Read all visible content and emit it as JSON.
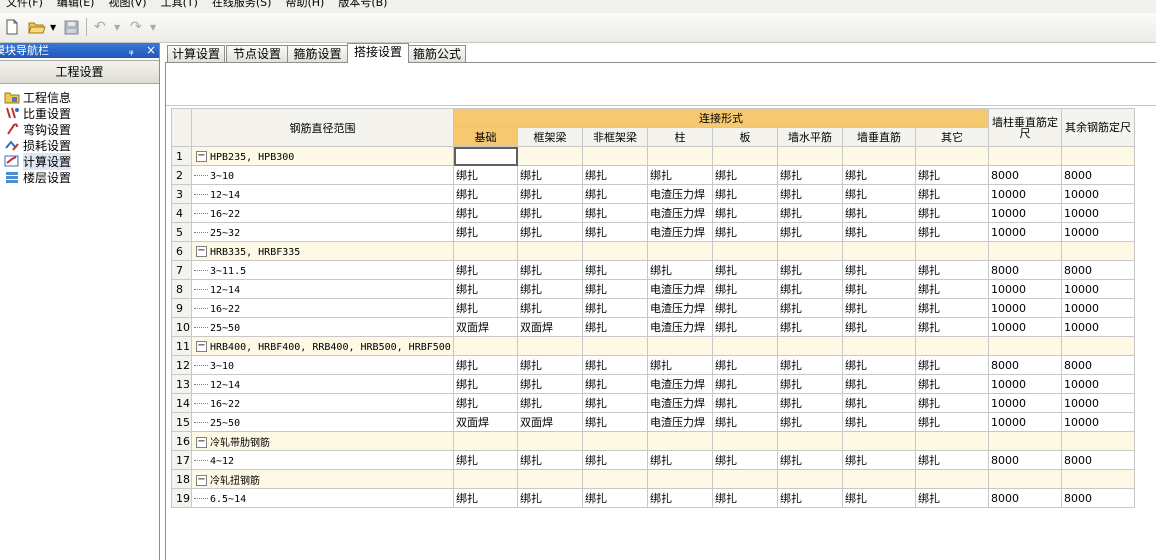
{
  "menu": [
    "文件(F)",
    "编辑(E)",
    "视图(V)",
    "工具(T)",
    "在线服务(S)",
    "帮助(H)",
    "版本号(B)"
  ],
  "nav": {
    "title": "模块导航栏",
    "pin_glyph": "ᵩ",
    "close_glyph": "×",
    "header": "工程设置",
    "items": [
      {
        "label": "工程信息",
        "icon": "folder-info-icon"
      },
      {
        "label": "比重设置",
        "icon": "weight-icon"
      },
      {
        "label": "弯钩设置",
        "icon": "hook-icon"
      },
      {
        "label": "损耗设置",
        "icon": "loss-icon"
      },
      {
        "label": "计算设置",
        "icon": "calc-settings-icon",
        "selected": true
      },
      {
        "label": "楼层设置",
        "icon": "floor-icon"
      }
    ]
  },
  "tabs": [
    {
      "label": "计算设置"
    },
    {
      "label": "节点设置"
    },
    {
      "label": "箍筋设置"
    },
    {
      "label": "搭接设置",
      "active": true
    },
    {
      "label": "箍筋公式"
    }
  ],
  "table": {
    "header": {
      "range": "钢筋直径范围",
      "connect": "连接形式",
      "cols": [
        "基础",
        "框架梁",
        "非框架梁",
        "柱",
        "板",
        "墙水平筋",
        "墙垂直筋",
        "其它"
      ],
      "wall_len": "墙柱垂直筋定尺",
      "other_len": "其余钢筋定尺"
    },
    "rows": [
      {
        "n": "1",
        "group": true,
        "name": "HPB235, HPB300"
      },
      {
        "n": "2",
        "name": "3~10",
        "vals": [
          "绑扎",
          "绑扎",
          "绑扎",
          "绑扎",
          "绑扎",
          "绑扎",
          "绑扎",
          "绑扎"
        ],
        "l1": "8000",
        "l2": "8000"
      },
      {
        "n": "3",
        "name": "12~14",
        "vals": [
          "绑扎",
          "绑扎",
          "绑扎",
          "电渣压力焊",
          "绑扎",
          "绑扎",
          "绑扎",
          "绑扎"
        ],
        "l1": "10000",
        "l2": "10000"
      },
      {
        "n": "4",
        "name": "16~22",
        "vals": [
          "绑扎",
          "绑扎",
          "绑扎",
          "电渣压力焊",
          "绑扎",
          "绑扎",
          "绑扎",
          "绑扎"
        ],
        "l1": "10000",
        "l2": "10000"
      },
      {
        "n": "5",
        "name": "25~32",
        "vals": [
          "绑扎",
          "绑扎",
          "绑扎",
          "电渣压力焊",
          "绑扎",
          "绑扎",
          "绑扎",
          "绑扎"
        ],
        "l1": "10000",
        "l2": "10000"
      },
      {
        "n": "6",
        "group": true,
        "name": "HRB335, HRBF335"
      },
      {
        "n": "7",
        "name": "3~11.5",
        "vals": [
          "绑扎",
          "绑扎",
          "绑扎",
          "绑扎",
          "绑扎",
          "绑扎",
          "绑扎",
          "绑扎"
        ],
        "l1": "8000",
        "l2": "8000"
      },
      {
        "n": "8",
        "name": "12~14",
        "vals": [
          "绑扎",
          "绑扎",
          "绑扎",
          "电渣压力焊",
          "绑扎",
          "绑扎",
          "绑扎",
          "绑扎"
        ],
        "l1": "10000",
        "l2": "10000"
      },
      {
        "n": "9",
        "name": "16~22",
        "vals": [
          "绑扎",
          "绑扎",
          "绑扎",
          "电渣压力焊",
          "绑扎",
          "绑扎",
          "绑扎",
          "绑扎"
        ],
        "l1": "10000",
        "l2": "10000"
      },
      {
        "n": "10",
        "name": "25~50",
        "vals": [
          "双面焊",
          "双面焊",
          "绑扎",
          "电渣压力焊",
          "绑扎",
          "绑扎",
          "绑扎",
          "绑扎"
        ],
        "l1": "10000",
        "l2": "10000"
      },
      {
        "n": "11",
        "group": true,
        "name": "HRB400, HRBF400, RRB400, HRB500, HRBF500"
      },
      {
        "n": "12",
        "name": "3~10",
        "vals": [
          "绑扎",
          "绑扎",
          "绑扎",
          "绑扎",
          "绑扎",
          "绑扎",
          "绑扎",
          "绑扎"
        ],
        "l1": "8000",
        "l2": "8000"
      },
      {
        "n": "13",
        "name": "12~14",
        "vals": [
          "绑扎",
          "绑扎",
          "绑扎",
          "电渣压力焊",
          "绑扎",
          "绑扎",
          "绑扎",
          "绑扎"
        ],
        "l1": "10000",
        "l2": "10000"
      },
      {
        "n": "14",
        "name": "16~22",
        "vals": [
          "绑扎",
          "绑扎",
          "绑扎",
          "电渣压力焊",
          "绑扎",
          "绑扎",
          "绑扎",
          "绑扎"
        ],
        "l1": "10000",
        "l2": "10000"
      },
      {
        "n": "15",
        "name": "25~50",
        "vals": [
          "双面焊",
          "双面焊",
          "绑扎",
          "电渣压力焊",
          "绑扎",
          "绑扎",
          "绑扎",
          "绑扎"
        ],
        "l1": "10000",
        "l2": "10000"
      },
      {
        "n": "16",
        "group": true,
        "name": "冷轧带肋钢筋"
      },
      {
        "n": "17",
        "name": "4~12",
        "vals": [
          "绑扎",
          "绑扎",
          "绑扎",
          "绑扎",
          "绑扎",
          "绑扎",
          "绑扎",
          "绑扎"
        ],
        "l1": "8000",
        "l2": "8000"
      },
      {
        "n": "18",
        "group": true,
        "name": "冷轧扭钢筋"
      },
      {
        "n": "19",
        "name": "6.5~14",
        "vals": [
          "绑扎",
          "绑扎",
          "绑扎",
          "绑扎",
          "绑扎",
          "绑扎",
          "绑扎",
          "绑扎"
        ],
        "l1": "8000",
        "l2": "8000"
      }
    ]
  }
}
